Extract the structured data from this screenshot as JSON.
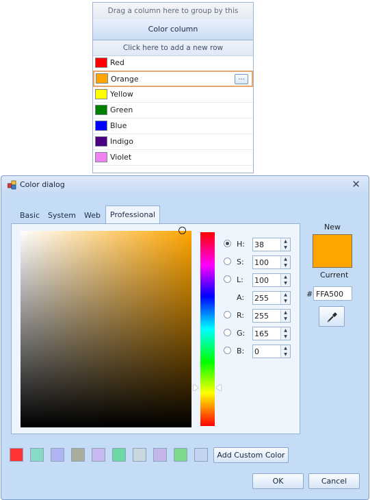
{
  "grid": {
    "group_panel_text": "Drag a column here to group by this column.",
    "column_header": "Color column",
    "new_row_text": "Click here to add a new row",
    "edit_button_label": "...",
    "rows": [
      {
        "name": "Red",
        "color": "#ff0000"
      },
      {
        "name": "Orange",
        "color": "#ffa500"
      },
      {
        "name": "Yellow",
        "color": "#ffff00"
      },
      {
        "name": "Green",
        "color": "#008000"
      },
      {
        "name": "Blue",
        "color": "#0000ff"
      },
      {
        "name": "Indigo",
        "color": "#4b0082"
      },
      {
        "name": "Violet",
        "color": "#ee82ee"
      }
    ]
  },
  "dialog": {
    "title": "Color dialog",
    "close_glyph": "✕",
    "tabs": [
      "Basic",
      "System",
      "Web",
      "Professional"
    ],
    "selected_tab": "Professional",
    "params": [
      {
        "label": "H:",
        "value": "38",
        "radio": true,
        "checked": true
      },
      {
        "label": "S:",
        "value": "100",
        "radio": true,
        "checked": false
      },
      {
        "label": "L:",
        "value": "100",
        "radio": true,
        "checked": false
      },
      {
        "label": "A:",
        "value": "255",
        "radio": false,
        "checked": false
      },
      {
        "label": "R:",
        "value": "255",
        "radio": true,
        "checked": false
      },
      {
        "label": "G:",
        "value": "165",
        "radio": true,
        "checked": false
      },
      {
        "label": "B:",
        "value": "0",
        "radio": true,
        "checked": false
      }
    ],
    "new_label": "New",
    "current_label": "Current",
    "new_color": "#ffa500",
    "hex_prefix": "#",
    "hex_value": "FFA500",
    "custom_colors": [
      "#ff3333",
      "#88d9c6",
      "#b1b4f2",
      "#a9ae9c",
      "#c6b8f0",
      "#6fd6a6",
      "#c9d8df",
      "#c4b6ec",
      "#7cdb8c",
      "#c5d3f2"
    ],
    "add_custom_label": "Add Custom Color",
    "ok_label": "OK",
    "cancel_label": "Cancel"
  }
}
